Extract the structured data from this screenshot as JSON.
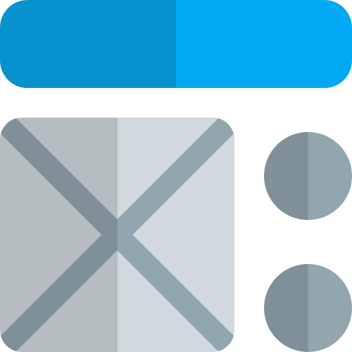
{
  "icon": {
    "name": "layout-template-icon",
    "colors": {
      "header_left": "#0891CF",
      "header_right": "#03A9F4",
      "panel_left": "#B5BDC0",
      "panel_right": "#D1D9DF",
      "cross_left": "#7F9099",
      "cross_right": "#91A6AF",
      "dot_left": "#7F9099",
      "dot_right": "#91A6AF"
    },
    "parts": [
      "header-bar",
      "image-placeholder",
      "top-dot",
      "bottom-dot"
    ]
  }
}
